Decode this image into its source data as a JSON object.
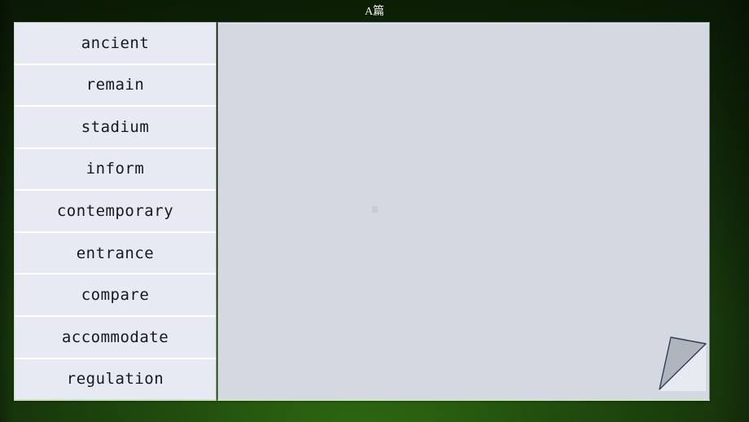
{
  "slide": {
    "title": "A篇",
    "background_color": "#10280a",
    "accent_green": "#2a6210"
  },
  "wordlist": {
    "panel_color": "#e7eaf2",
    "items": [
      {
        "word": "ancient"
      },
      {
        "word": "remain"
      },
      {
        "word": "stadium"
      },
      {
        "word": "inform"
      },
      {
        "word": "contemporary"
      },
      {
        "word": "entrance"
      },
      {
        "word": "compare"
      },
      {
        "word": "accommodate"
      },
      {
        "word": "regulation"
      }
    ]
  },
  "content": {
    "panel_color": "#d4d9e1",
    "border_color": "#6c7d98",
    "marker": "placeholder-square",
    "body_text": "",
    "curl": {
      "name": "page-curl-corner",
      "fill_color": "#b0b4bd",
      "under_color": "#e8eaf2",
      "outline_color": "#2e3f5c"
    }
  }
}
